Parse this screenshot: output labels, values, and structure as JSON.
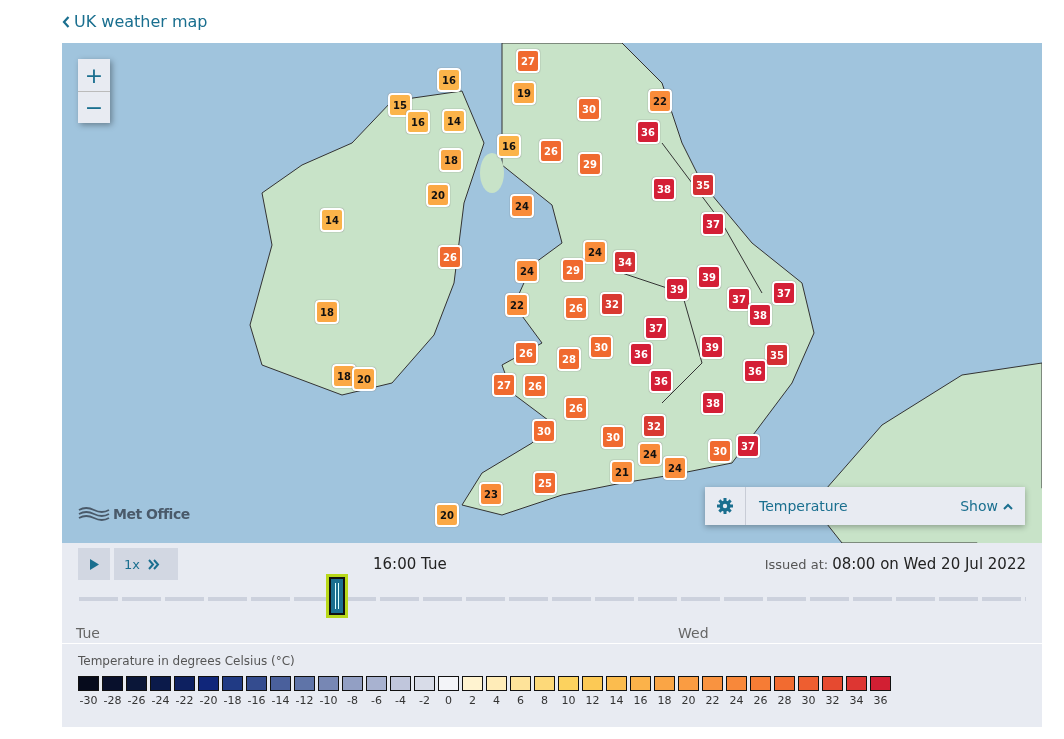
{
  "back_link": "UK weather map",
  "map": {
    "zoom_in": "+",
    "zoom_out": "−",
    "logo": "Met Office",
    "markers": [
      {
        "value": "27",
        "color": "#f06a2f"
      },
      {
        "value": "16",
        "color": "#fbb44a"
      },
      {
        "value": "19",
        "color": "#fba844"
      },
      {
        "value": "30",
        "color": "#f06a2f"
      },
      {
        "value": "22",
        "color": "#f98c3a"
      },
      {
        "value": "15",
        "color": "#fbb44a"
      },
      {
        "value": "16",
        "color": "#fbb44a"
      },
      {
        "value": "14",
        "color": "#fbb44a"
      },
      {
        "value": "36",
        "color": "#d41f36"
      },
      {
        "value": "16",
        "color": "#fbb44a"
      },
      {
        "value": "26",
        "color": "#f06a2f"
      },
      {
        "value": "18",
        "color": "#fba844"
      },
      {
        "value": "29",
        "color": "#f06a2f"
      },
      {
        "value": "38",
        "color": "#d41f36"
      },
      {
        "value": "35",
        "color": "#d42e33"
      },
      {
        "value": "20",
        "color": "#fba844"
      },
      {
        "value": "24",
        "color": "#f98c3a"
      },
      {
        "value": "14",
        "color": "#fbb44a"
      },
      {
        "value": "37",
        "color": "#d41f36"
      },
      {
        "value": "24",
        "color": "#f98c3a"
      },
      {
        "value": "26",
        "color": "#f06a2f"
      },
      {
        "value": "34",
        "color": "#d42e33"
      },
      {
        "value": "29",
        "color": "#f06a2f"
      },
      {
        "value": "24",
        "color": "#f98c3a"
      },
      {
        "value": "39",
        "color": "#d41f36"
      },
      {
        "value": "37",
        "color": "#d41f36"
      },
      {
        "value": "39",
        "color": "#d41f36"
      },
      {
        "value": "37",
        "color": "#d41f36"
      },
      {
        "value": "22",
        "color": "#f98c3a"
      },
      {
        "value": "26",
        "color": "#f06a2f"
      },
      {
        "value": "32",
        "color": "#d93a31"
      },
      {
        "value": "38",
        "color": "#d41f36"
      },
      {
        "value": "18",
        "color": "#fba844"
      },
      {
        "value": "37",
        "color": "#d41f36"
      },
      {
        "value": "30",
        "color": "#f06a2f"
      },
      {
        "value": "39",
        "color": "#d41f36"
      },
      {
        "value": "26",
        "color": "#f06a2f"
      },
      {
        "value": "28",
        "color": "#f06a2f"
      },
      {
        "value": "36",
        "color": "#d41f36"
      },
      {
        "value": "35",
        "color": "#d42e33"
      },
      {
        "value": "18",
        "color": "#fba844"
      },
      {
        "value": "20",
        "color": "#fba844"
      },
      {
        "value": "36",
        "color": "#d41f36"
      },
      {
        "value": "27",
        "color": "#f06a2f"
      },
      {
        "value": "26",
        "color": "#f06a2f"
      },
      {
        "value": "36",
        "color": "#d41f36"
      },
      {
        "value": "26",
        "color": "#f06a2f"
      },
      {
        "value": "38",
        "color": "#d41f36"
      },
      {
        "value": "30",
        "color": "#f06a2f"
      },
      {
        "value": "32",
        "color": "#d93a31"
      },
      {
        "value": "30",
        "color": "#f06a2f"
      },
      {
        "value": "24",
        "color": "#f98c3a"
      },
      {
        "value": "30",
        "color": "#f06a2f"
      },
      {
        "value": "37",
        "color": "#d41f36"
      },
      {
        "value": "21",
        "color": "#f98c3a"
      },
      {
        "value": "24",
        "color": "#f98c3a"
      },
      {
        "value": "23",
        "color": "#f98c3a"
      },
      {
        "value": "25",
        "color": "#f06a2f"
      },
      {
        "value": "20",
        "color": "#fba844"
      }
    ],
    "layer_panel": {
      "label": "Temperature",
      "toggle": "Show"
    }
  },
  "timeline": {
    "speed": "1x",
    "current_time": "16:00 Tue",
    "issued_label": "Issued at:",
    "issued_value": "08:00 on Wed 20 Jul 2022",
    "days": [
      "Tue",
      "Wed"
    ]
  },
  "legend": {
    "title": "Temperature in degrees Celsius (°C)",
    "steps": [
      {
        "label": "-30",
        "color": "#060b1c"
      },
      {
        "label": "-28",
        "color": "#08102c"
      },
      {
        "label": "-26",
        "color": "#0a1638"
      },
      {
        "label": "-24",
        "color": "#0b1a4a"
      },
      {
        "label": "-22",
        "color": "#0d2060"
      },
      {
        "label": "-20",
        "color": "#10267a"
      },
      {
        "label": "-18",
        "color": "#203a84"
      },
      {
        "label": "-16",
        "color": "#344c8f"
      },
      {
        "label": "-14",
        "color": "#4a609c"
      },
      {
        "label": "-12",
        "color": "#5f74a8"
      },
      {
        "label": "-10",
        "color": "#7787b4"
      },
      {
        "label": "-8",
        "color": "#929fc4"
      },
      {
        "label": "-6",
        "color": "#a8b2d0"
      },
      {
        "label": "-4",
        "color": "#c0c6dc"
      },
      {
        "label": "-2",
        "color": "#d8dce8"
      },
      {
        "label": "0",
        "color": "#f3f4f8"
      },
      {
        "label": "2",
        "color": "#fff3d0"
      },
      {
        "label": "4",
        "color": "#ffecb8"
      },
      {
        "label": "6",
        "color": "#fee39a"
      },
      {
        "label": "8",
        "color": "#fdd979"
      },
      {
        "label": "10",
        "color": "#fcd25e"
      },
      {
        "label": "12",
        "color": "#fcc955"
      },
      {
        "label": "14",
        "color": "#fbbc4e"
      },
      {
        "label": "16",
        "color": "#fbb24a"
      },
      {
        "label": "18",
        "color": "#faa545"
      },
      {
        "label": "20",
        "color": "#fa9c42"
      },
      {
        "label": "22",
        "color": "#f99340"
      },
      {
        "label": "24",
        "color": "#f8883a"
      },
      {
        "label": "26",
        "color": "#f67c35"
      },
      {
        "label": "28",
        "color": "#f26b30"
      },
      {
        "label": "30",
        "color": "#ee5e30"
      },
      {
        "label": "32",
        "color": "#e64a30"
      },
      {
        "label": "34",
        "color": "#dd3632"
      },
      {
        "label": "36",
        "color": "#d21f33"
      }
    ]
  }
}
